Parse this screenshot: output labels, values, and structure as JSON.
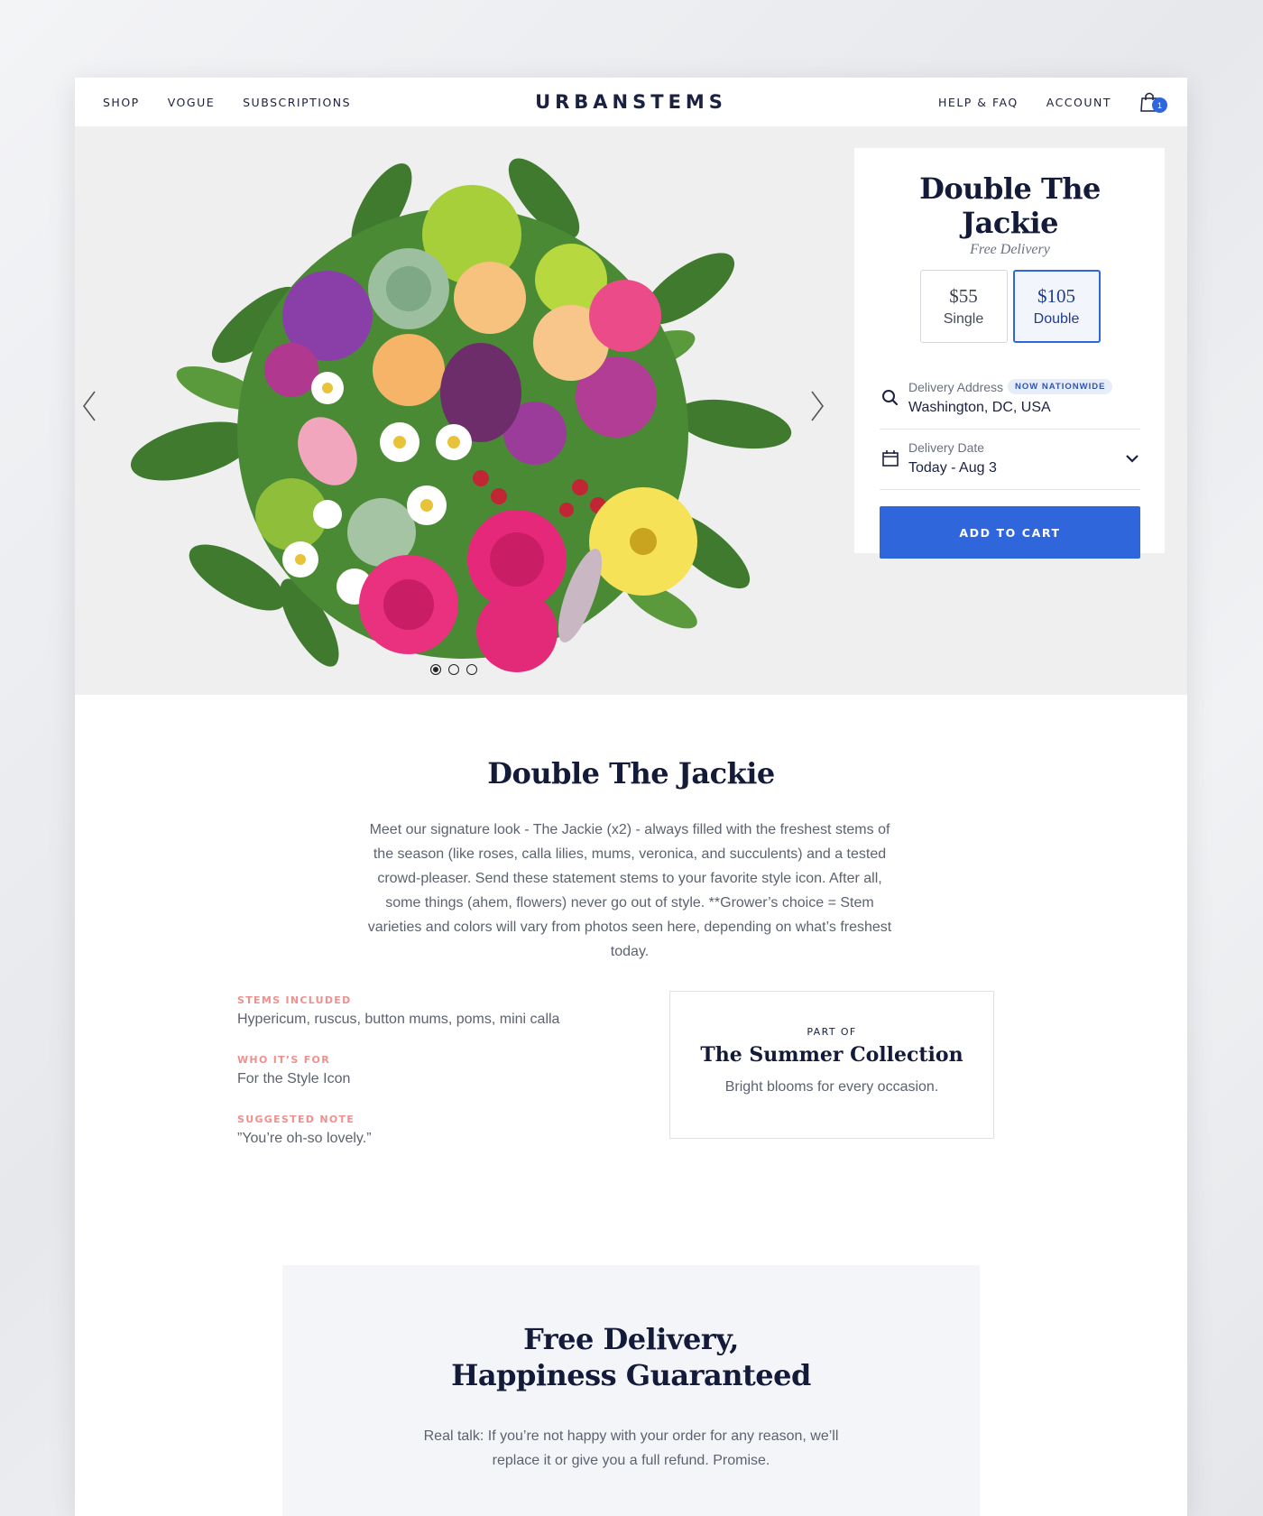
{
  "nav": {
    "left": [
      {
        "label": "SHOP"
      },
      {
        "label": "VOGUE"
      },
      {
        "label": "SUBSCRIPTIONS"
      }
    ],
    "logo": "URBANSTEMS",
    "right": [
      {
        "label": "HELP & FAQ"
      },
      {
        "label": "ACCOUNT"
      }
    ],
    "cart_count": "1"
  },
  "hero": {
    "carousel_total": 3,
    "carousel_active": 1
  },
  "product": {
    "title": "Double The Jackie",
    "subtitle": "Free Delivery",
    "options": [
      {
        "price": "$55",
        "label": "Single",
        "selected": false
      },
      {
        "price": "$105",
        "label": "Double",
        "selected": true
      }
    ],
    "address": {
      "label": "Delivery Address",
      "badge": "NOW NATIONWIDE",
      "value": "Washington, DC, USA"
    },
    "date": {
      "label": "Delivery Date",
      "value": "Today - Aug 3"
    },
    "cta": "ADD TO CART"
  },
  "description": {
    "title": "Double The Jackie",
    "text": "Meet our signature look - The Jackie (x2) - always filled with the freshest stems of the season (like roses, calla lilies, mums, veronica, and succulents) and a tested crowd-pleaser. Send these statement stems to your favorite style icon. After all, some things (ahem, flowers) never go out of style. **Grower’s choice = Stem varieties and colors will vary from photos seen here, depending on what’s freshest today."
  },
  "specs": [
    {
      "label": "STEMS INCLUDED",
      "value": "Hypericum, ruscus, button mums, poms, mini calla"
    },
    {
      "label": "WHO IT’S FOR",
      "value": "For the Style Icon"
    },
    {
      "label": "SUGGESTED NOTE",
      "value": "”You’re oh-so lovely.”"
    }
  ],
  "collection": {
    "eyebrow": "PART OF",
    "title": "The Summer Collection",
    "description": "Bright blooms for every occasion."
  },
  "guarantee": {
    "title": "Free Delivery, Happiness Guaranteed",
    "text": "Real talk: If you’re not happy with your order for any reason, we’ll replace it or give you a full refund. Promise."
  },
  "colors": {
    "accent": "#2f66dc",
    "navy": "#141a3a",
    "coral": "#f0908e"
  },
  "icons": [
    "cart-icon",
    "chevron-left-icon",
    "chevron-right-icon",
    "search-icon",
    "calendar-icon",
    "chevron-down-icon"
  ]
}
